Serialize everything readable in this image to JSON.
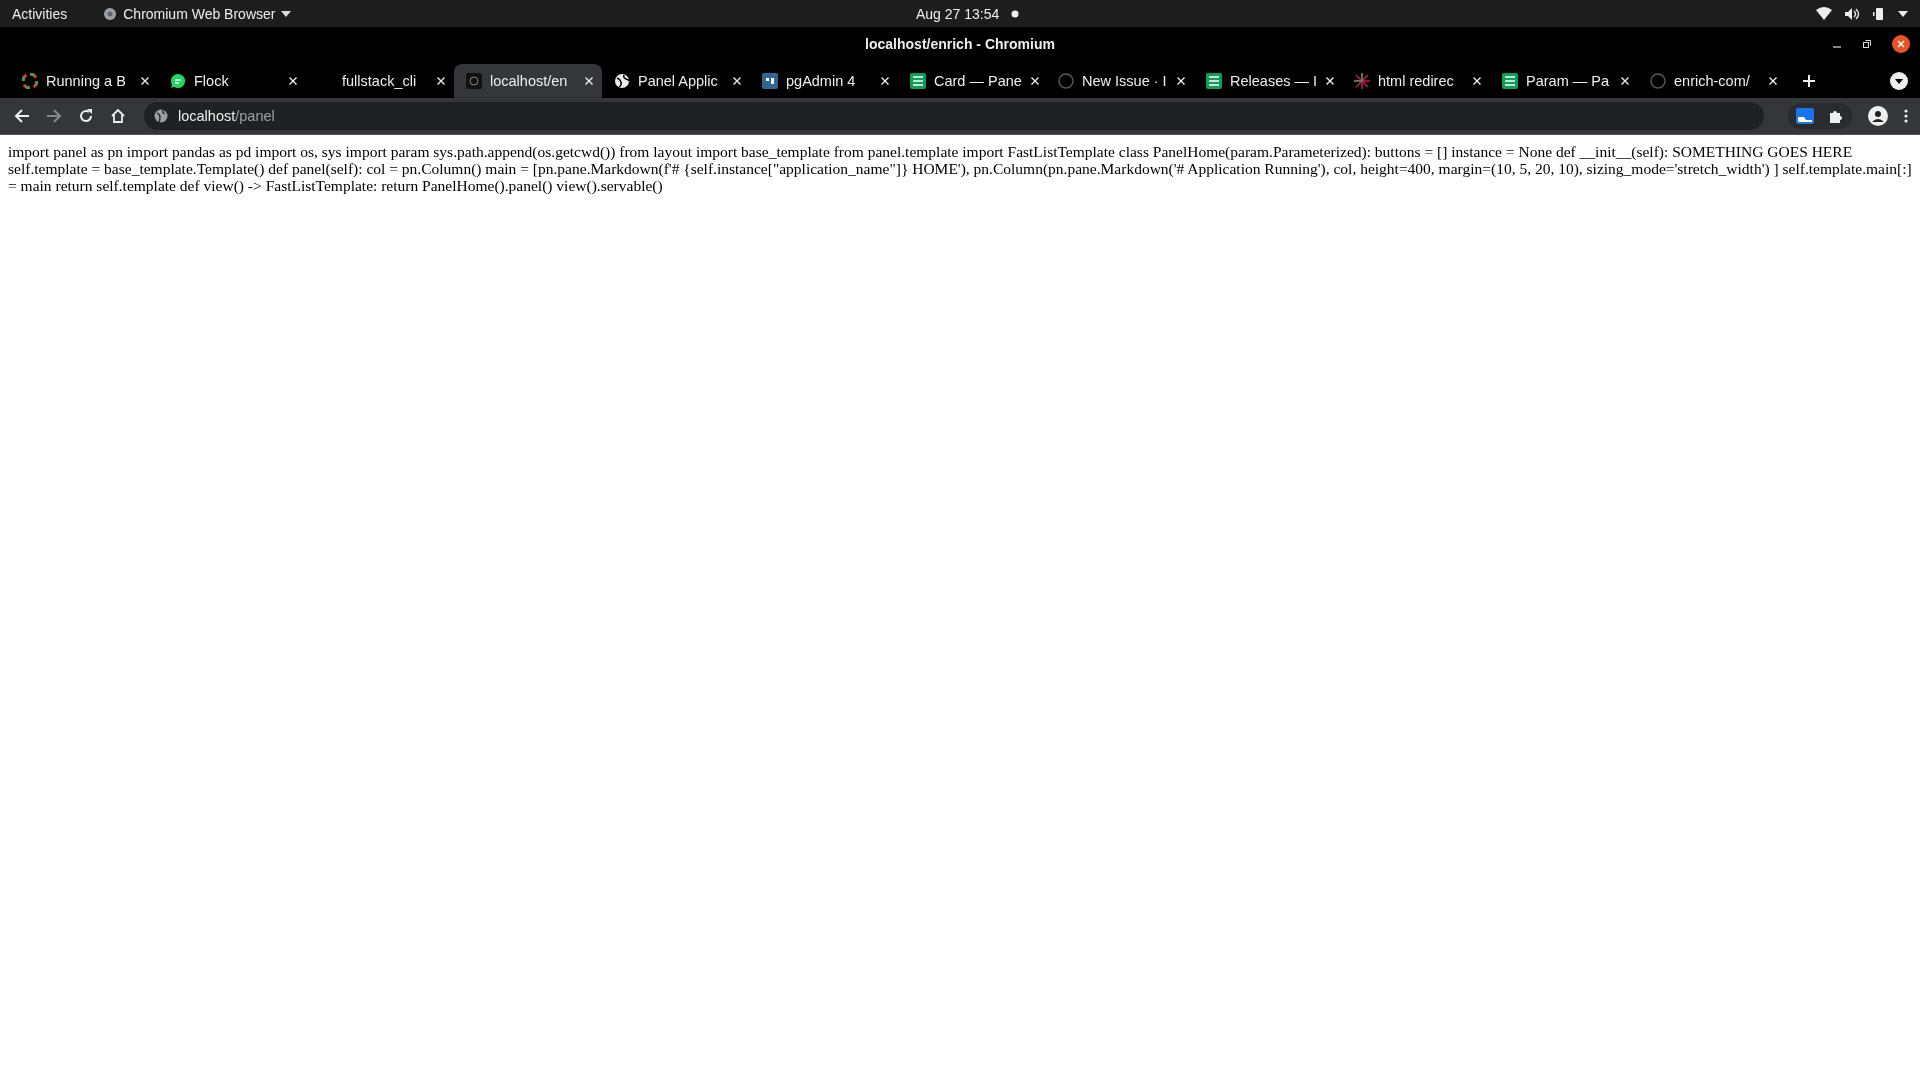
{
  "system_bar": {
    "activities": "Activities",
    "app_menu": "Chromium Web Browser",
    "clock": "Aug 27  13:54"
  },
  "window": {
    "title": "localhost/enrich - Chromium"
  },
  "tabs": [
    {
      "label": "Running a B",
      "kind": "wheel",
      "selected": false
    },
    {
      "label": "Flock",
      "kind": "chat",
      "selected": false
    },
    {
      "label": "fullstack_cli",
      "kind": "blank",
      "selected": false
    },
    {
      "label": "localhost/en",
      "kind": "dark",
      "selected": true
    },
    {
      "label": "Panel Applic",
      "kind": "globe",
      "selected": false
    },
    {
      "label": "pgAdmin 4",
      "kind": "pg",
      "selected": false
    },
    {
      "label": "Card — Pane",
      "kind": "sheet",
      "selected": false
    },
    {
      "label": "New Issue · I",
      "kind": "github",
      "selected": false
    },
    {
      "label": "Releases — I",
      "kind": "sheet",
      "selected": false
    },
    {
      "label": "html redirec",
      "kind": "spark",
      "selected": false
    },
    {
      "label": "Param — Pa",
      "kind": "sheet",
      "selected": false
    },
    {
      "label": "enrich-com/",
      "kind": "github",
      "selected": false
    }
  ],
  "address": {
    "host": "localhost",
    "path": "/panel"
  },
  "content": "import panel as pn import pandas as pd import os, sys import param sys.path.append(os.getcwd()) from layout import base_template from panel.template import FastListTemplate class PanelHome(param.Parameterized): buttons = [] instance = None def __init__(self): SOMETHING GOES HERE self.template = base_template.Template() def panel(self): col = pn.Column() main = [pn.pane.Markdown(f'# {self.instance[\"application_name\"]} HOME'), pn.Column(pn.pane.Markdown('# Application Running'), col, height=400, margin=(10, 5, 20, 10), sizing_mode='stretch_width') ] self.template.main[:] = main return self.template def view() -> FastListTemplate: return PanelHome().panel() view().servable()"
}
